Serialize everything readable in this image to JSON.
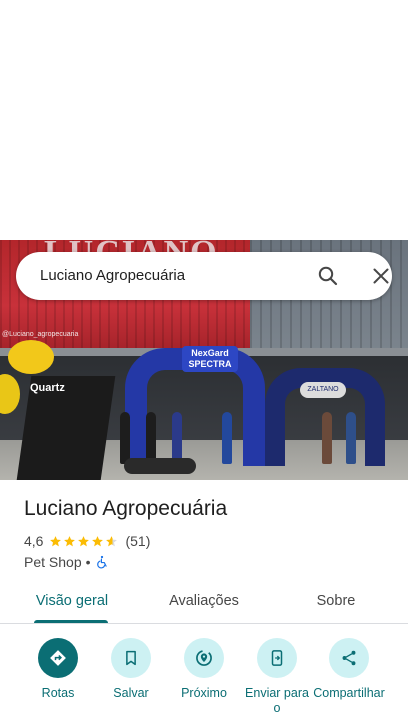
{
  "search": {
    "query": "Luciano Agropecuária"
  },
  "hero": {
    "facade_text": "LUCIANO",
    "handle_text": "@Luciano_agropecuaria",
    "inflatable_brand": "NexGard SPECTRA",
    "tent_brand": "ZALTANO",
    "banner_brand": "Quartz"
  },
  "place": {
    "name": "Luciano Agropecuária",
    "rating": "4,6",
    "stars_value": 4.6,
    "reviews": "(51)",
    "category": "Pet Shop",
    "separator": "•"
  },
  "tabs": [
    {
      "label": "Visão geral",
      "active": true
    },
    {
      "label": "Avaliações",
      "active": false
    },
    {
      "label": "Sobre",
      "active": false
    }
  ],
  "actions": [
    {
      "label": "Rotas",
      "icon": "directions-icon"
    },
    {
      "label": "Salvar",
      "icon": "bookmark-icon"
    },
    {
      "label": "Próximo",
      "icon": "nearby-icon"
    },
    {
      "label": "Enviar para o",
      "icon": "send-to-phone-icon"
    },
    {
      "label": "Compartilhar",
      "icon": "share-icon"
    }
  ],
  "colors": {
    "accent": "#0b6e74",
    "accent_light": "#cdf1f3",
    "star": "#fbbc04",
    "access": "#1a73e8"
  }
}
